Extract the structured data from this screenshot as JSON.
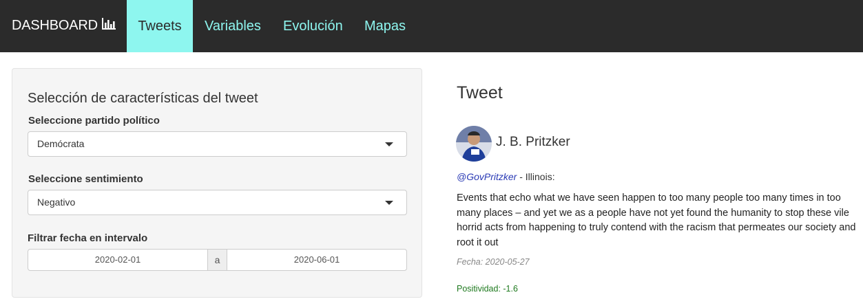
{
  "navbar": {
    "brand": "DASHBOARD",
    "brand_icon": "bar-chart-icon",
    "tabs": [
      {
        "label": "Tweets",
        "active": true
      },
      {
        "label": "Variables",
        "active": false
      },
      {
        "label": "Evolución",
        "active": false
      },
      {
        "label": "Mapas",
        "active": false
      }
    ]
  },
  "sidebar": {
    "title": "Selección de características del tweet",
    "party": {
      "label": "Seleccione partido político",
      "value": "Demócrata"
    },
    "sentiment": {
      "label": "Seleccione sentimiento",
      "value": "Negativo"
    },
    "daterange": {
      "label": "Filtrar fecha en intervalo",
      "start": "2020-02-01",
      "separator": "a",
      "end": "2020-06-01"
    }
  },
  "tweet": {
    "heading": "Tweet",
    "author": "J. B. Pritzker",
    "handle": "@GovPritzker",
    "location": " - Illinois:",
    "text": "Events that echo what we have seen happen to too many people too many times in too many places – and yet we as a people have not yet found the humanity to stop these vile horrid acts from happening to truly contend with the racism that permeates our society and root it out",
    "date": "Fecha: 2020-05-27",
    "score": "Positividad: -1.6"
  },
  "colors": {
    "navbar_bg": "#2b2b2b",
    "accent": "#8ef6ef",
    "handle": "#2a3ab5",
    "score": "#1f7a1f"
  }
}
